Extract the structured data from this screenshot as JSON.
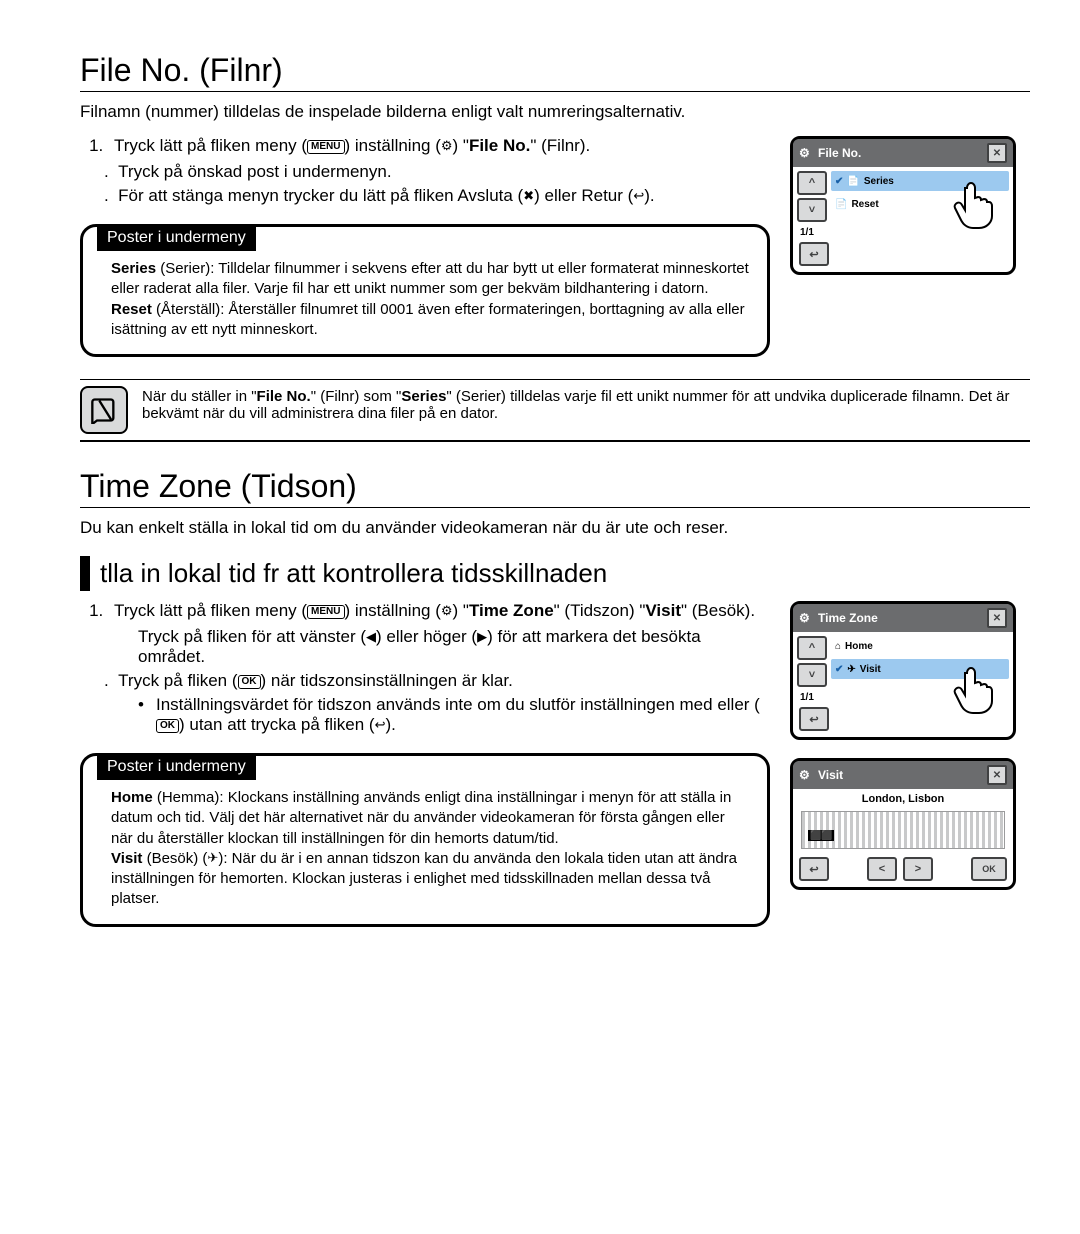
{
  "sec1": {
    "title": "File No. (Filnr)",
    "intro": "Filnamn (nummer) tilldelas de inspelade bilderna enligt valt numreringsalternativ.",
    "step1_a": "Tryck lätt på fliken meny (",
    "step1_b": ")      inställning (",
    "step1_c": ")      \"",
    "step1_d": "File No.",
    "step1_e": "\" (Filnr).",
    "step2": "Tryck på önskad post i undermenyn.",
    "step3_a": "För att stänga menyn trycker du lätt på fliken Avsluta (",
    "step3_b": ") eller Retur (",
    "step3_c": ").",
    "icon_menu": "MENU",
    "icon_ok": "OK",
    "poster_tab": "Poster i undermeny",
    "p1": {
      "b1": "Series",
      "t1": " (Serier): Tilldelar filnummer i sekvens efter att du har bytt ut eller formaterat minneskortet eller raderat alla filer. Varje fil har ett unikt nummer som ger bekväm bildhantering i datorn.",
      "b2": "Reset",
      "t2": " (Återställ): Återställer filnumret till 0001 även efter formateringen, borttagning av alla eller isättning av ett nytt minneskort."
    },
    "note_a": "När du ställer in \"",
    "note_b": "File No.",
    "note_c": "\" (Filnr) som \"",
    "note_d": "Series",
    "note_e": "\" (Serier) tilldelas varje fil ett unikt nummer för att undvika duplicerade filnamn. Det är bekvämt när du vill administrera dina filer på en dator.",
    "lcd_title": "File No.",
    "lcd_opt1": "Series",
    "lcd_opt2": "Reset",
    "lcd_page": "1/1"
  },
  "sec2": {
    "title": "Time Zone (Tidson)",
    "intro": "Du kan enkelt ställa in lokal tid om du använder videokameran när du är ute och reser.",
    "sub": "tlla in lokal tid fr att kontrollera tidsskillnaden",
    "s1_a": "Tryck lätt på fliken meny (",
    "s1_b": ")      inställning (",
    "s1_c": ")      \"",
    "s1_d": "Time Zone",
    "s1_e": "\" (Tidszon)      \"",
    "s1_f": "Visit",
    "s1_g": "\" (Besök).",
    "s2_a": "Tryck på fliken för att vänster (",
    "s2_b": ") eller höger (",
    "s2_c": ") för att markera det besökta området.",
    "s3_a": "Tryck på fliken (",
    "s3_b": ") när tidszonsinställningen är klar.",
    "s3b1_a": "Inställningsvärdet för tidszon används inte om du slutför inställningen med eller (",
    "s3b1_b": ") utan att trycka på fliken (",
    "s3b1_c": ").",
    "poster_tab": "Poster i undermeny",
    "p2": {
      "b1": "Home",
      "t1": " (Hemma): Klockans inställning används enligt dina inställningar i menyn för att ställa in datum och tid. Välj det här alternativet när du använder videokameran för första gången eller när du återställer klockan till inställningen för din hemorts datum/tid.",
      "b2": "Visit",
      "t2": " (Besök) (",
      "t2b": "): När du är i en annan tidszon kan du använda den lokala tiden utan att ändra inställningen för hemorten. Klockan justeras i enlighet med tidsskillnaden mellan dessa två platser."
    },
    "lcd1_title": "Time Zone",
    "lcd1_opt1": "Home",
    "lcd1_opt2": "Visit",
    "lcd1_page": "1/1",
    "lcd2_title": "Visit",
    "lcd2_city": "London, Lisbon",
    "btn_ok": "OK"
  }
}
